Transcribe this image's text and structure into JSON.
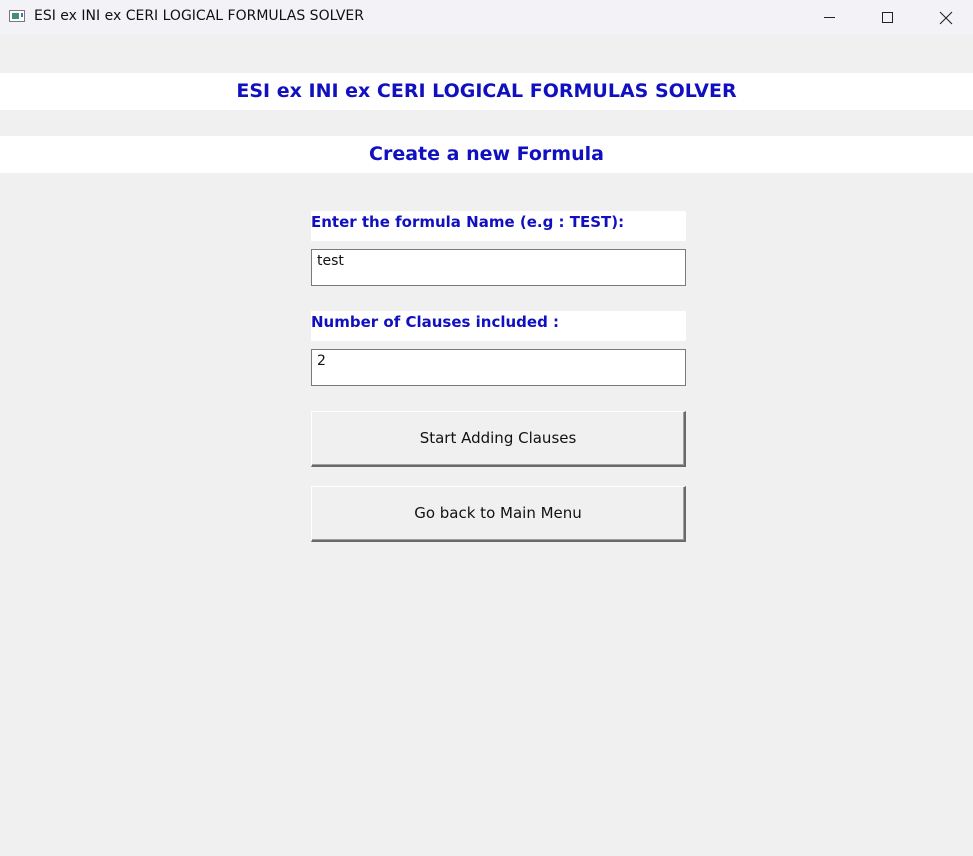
{
  "window": {
    "title": "ESI ex INI ex CERI LOGICAL FORMULAS SOLVER",
    "icon": "app-window-icon",
    "controls": {
      "minimize_icon": "minimize-icon",
      "maximize_icon": "maximize-icon",
      "close_icon": "close-icon"
    }
  },
  "header": {
    "app_title": "ESI ex INI ex CERI LOGICAL FORMULAS SOLVER",
    "subtitle": "Create a new Formula"
  },
  "form": {
    "name_label": "Enter the formula Name (e.g : TEST):",
    "name_value": "test",
    "clauses_label": "Number of Clauses included :",
    "clauses_value": "2"
  },
  "buttons": {
    "start_label": "Start Adding Clauses",
    "back_label": "Go back to Main Menu"
  },
  "colors": {
    "accent_text": "#1010c0",
    "background": "#f0f0f0",
    "banner": "#ffffff"
  }
}
